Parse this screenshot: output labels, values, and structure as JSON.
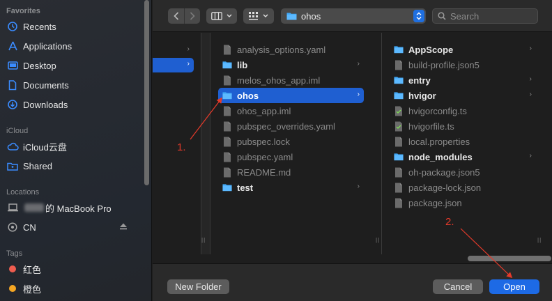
{
  "sidebar": {
    "sections": {
      "favorites": "Favorites",
      "icloud": "iCloud",
      "locations": "Locations",
      "tags": "Tags"
    },
    "favorites": [
      {
        "label": "Recents",
        "icon": "clock-icon"
      },
      {
        "label": "Applications",
        "icon": "applications-icon"
      },
      {
        "label": "Desktop",
        "icon": "desktop-icon"
      },
      {
        "label": "Documents",
        "icon": "document-icon"
      },
      {
        "label": "Downloads",
        "icon": "download-icon"
      }
    ],
    "icloud": [
      {
        "label": "iCloud云盘",
        "icon": "cloud-icon"
      },
      {
        "label": "Shared",
        "icon": "shared-folder-icon"
      }
    ],
    "locations": [
      {
        "label": "的 MacBook Pro",
        "icon": "laptop-icon"
      },
      {
        "label": "CN",
        "icon": "network-drive-icon"
      }
    ],
    "tags": [
      {
        "label": "红色",
        "color": "#ee5d4f"
      },
      {
        "label": "橙色",
        "color": "#f5a623"
      }
    ]
  },
  "toolbar": {
    "path_label": "ohos",
    "search_placeholder": "Search"
  },
  "column2": [
    {
      "label": "analysis_options.yaml",
      "kind": "file",
      "dim": true
    },
    {
      "label": "lib",
      "kind": "folder",
      "dim": false,
      "chevron": true
    },
    {
      "label": "melos_ohos_app.iml",
      "kind": "file",
      "dim": true
    },
    {
      "label": "ohos",
      "kind": "folder",
      "dim": false,
      "chevron": true,
      "selected": true
    },
    {
      "label": "ohos_app.iml",
      "kind": "file",
      "dim": true
    },
    {
      "label": "pubspec_overrides.yaml",
      "kind": "file",
      "dim": true
    },
    {
      "label": "pubspec.lock",
      "kind": "file",
      "dim": true
    },
    {
      "label": "pubspec.yaml",
      "kind": "file",
      "dim": true
    },
    {
      "label": "README.md",
      "kind": "file",
      "dim": true
    },
    {
      "label": "test",
      "kind": "folder",
      "dim": false,
      "chevron": true
    }
  ],
  "column3": [
    {
      "label": "AppScope",
      "kind": "folder",
      "dim": false,
      "chevron": true
    },
    {
      "label": "build-profile.json5",
      "kind": "file",
      "dim": true
    },
    {
      "label": "entry",
      "kind": "folder",
      "dim": false,
      "chevron": true
    },
    {
      "label": "hvigor",
      "kind": "folder",
      "dim": false,
      "chevron": true
    },
    {
      "label": "hvigorconfig.ts",
      "kind": "script",
      "dim": true
    },
    {
      "label": "hvigorfile.ts",
      "kind": "script",
      "dim": true
    },
    {
      "label": "local.properties",
      "kind": "file",
      "dim": true
    },
    {
      "label": "node_modules",
      "kind": "folder",
      "dim": false,
      "chevron": true
    },
    {
      "label": "oh-package.json5",
      "kind": "file",
      "dim": true
    },
    {
      "label": "package-lock.json",
      "kind": "file",
      "dim": true
    },
    {
      "label": "package.json",
      "kind": "file",
      "dim": true
    }
  ],
  "footer": {
    "new_folder": "New Folder",
    "cancel": "Cancel",
    "open": "Open"
  },
  "annotations": {
    "step1": "1.",
    "step2": "2.",
    "color": "#e53a2a"
  }
}
